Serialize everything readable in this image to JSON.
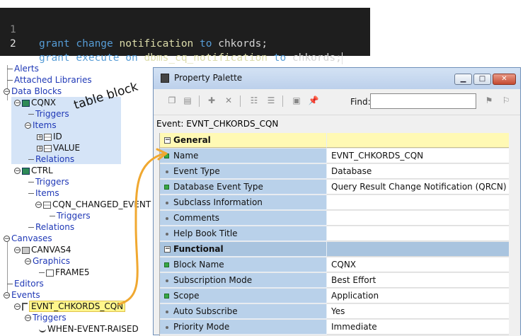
{
  "code_editor": {
    "lines": [
      {
        "num": "1",
        "kw1": "grant",
        "kw2": "change",
        "ident": "notification",
        "kw3": "to",
        "target": "chkords;"
      },
      {
        "num": "2",
        "kw1": "grant",
        "kw2": "execute",
        "kw_on": "on",
        "ident": "dbms_cq_notification",
        "kw3": "to",
        "target": "chkords;"
      }
    ]
  },
  "tree": {
    "alerts": "Alerts",
    "attached_libraries": "Attached Libraries",
    "data_blocks": "Data Blocks",
    "cqnx": "CQNX",
    "cqnx_triggers": "Triggers",
    "cqnx_items": "Items",
    "item_id": "ID",
    "item_value": "VALUE",
    "cqnx_relations": "Relations",
    "ctrl": "CTRL",
    "ctrl_triggers": "Triggers",
    "ctrl_items": "Items",
    "cqn_changed_event": "CQN_CHANGED_EVENT",
    "cqn_changed_triggers": "Triggers",
    "ctrl_relations": "Relations",
    "canvases": "Canvases",
    "canvas4": "CANVAS4",
    "graphics": "Graphics",
    "frame5": "FRAME5",
    "editors": "Editors",
    "events": "Events",
    "evnt": "EVNT_CHKORDS_CQN",
    "evnt_triggers": "Triggers",
    "when_event_raised": "WHEN-EVENT-RAISED",
    "annotation": "table block"
  },
  "palette": {
    "title": "Property Palette",
    "find_label": "Find:",
    "find_value": "",
    "context": "Event: EVNT_CHKORDS_CQN",
    "rows": [
      {
        "type": "category",
        "name": "General",
        "value": ""
      },
      {
        "type": "set",
        "name": "Name",
        "value": "EVNT_CHKORDS_CQN"
      },
      {
        "type": "default",
        "name": "Event Type",
        "value": "Database"
      },
      {
        "type": "set",
        "name": "Database Event Type",
        "value": "Query Result Change Notification (QRCN)"
      },
      {
        "type": "default",
        "name": "Subclass Information",
        "value": ""
      },
      {
        "type": "default",
        "name": "Comments",
        "value": ""
      },
      {
        "type": "default",
        "name": "Help Book Title",
        "value": ""
      },
      {
        "type": "category",
        "name": "Functional",
        "value": ""
      },
      {
        "type": "set",
        "name": "Block Name",
        "value": "CQNX"
      },
      {
        "type": "default",
        "name": "Subscription Mode",
        "value": "Best Effort"
      },
      {
        "type": "set",
        "name": "Scope",
        "value": "Application"
      },
      {
        "type": "default",
        "name": "Auto Subscribe",
        "value": "Yes"
      },
      {
        "type": "default",
        "name": "Priority Mode",
        "value": "Immediate"
      }
    ]
  },
  "colors": {
    "editor_bg": "#1e1e1e",
    "keyword": "#569cd6",
    "identifier": "#dcdcaa",
    "tree_highlight": "#d5e4f7",
    "arrow": "#f0a830",
    "general_row": "#fff9b4",
    "functional_row": "#a9c4df",
    "name_column": "#b9d1ea"
  }
}
